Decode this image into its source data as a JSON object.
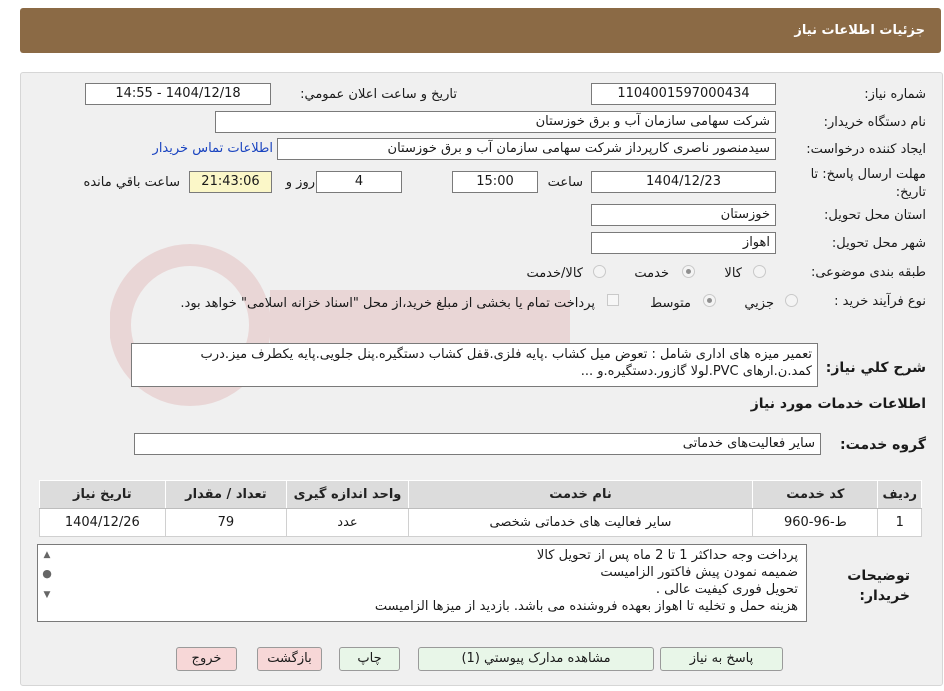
{
  "header": {
    "title": "جزئیات اطلاعات نیاز"
  },
  "fields": {
    "need_number_label": "شماره نیاز:",
    "need_number": "1104001597000434",
    "announce_label": "تاریخ و ساعت اعلان عمومي:",
    "announce_value": "1404/12/18 - 14:55",
    "buyer_org_label": "نام دستگاه خريدار:",
    "buyer_org": "شرکت سهامی سازمان آب و برق خوزستان",
    "requester_label": "ايجاد کننده درخواست:",
    "requester": "سیدمنصور ناصری کارپرداز شرکت سهامی سازمان آب و برق خوزستان",
    "contact_link": "اطلاعات تماس خريدار",
    "deadline_label": "مهلت ارسال پاسخ: تا تاریخ:",
    "deadline_date": "1404/12/23",
    "time_label": "ساعت",
    "deadline_time": "15:00",
    "days_value": "4",
    "days_label": "روز و",
    "remaining_time": "21:43:06",
    "remaining_label": "ساعت باقي مانده",
    "province_label": "استان محل تحويل:",
    "province": "خوزستان",
    "city_label": "شهر محل تحويل:",
    "city": "اهواز",
    "category_label": "طبقه بندی موضوعی:",
    "category_options": [
      "کالا",
      "خدمت",
      "کالا/خدمت"
    ],
    "category_selected": "خدمت",
    "process_label": "نوع فرآیند خرید :",
    "process_options": [
      "جزيي",
      "متوسط"
    ],
    "process_selected": "متوسط",
    "payment_note": "پرداخت تمام یا بخشی از مبلغ خرید،از محل \"اسناد خزانه اسلامی\" خواهد بود."
  },
  "description": {
    "label": "شرح کلي نياز:",
    "text": "تعمیر میزه های اداری شامل : تعوض میل کشاب .پایه فلزی.قفل کشاب دستگیره.پنل جلویی.پایه یکطرف میز.درب کمد.ن.ارهای PVC.لولا گازور.دستگیره.و ..."
  },
  "services": {
    "section_title": "اطلاعات خدمات مورد نياز",
    "group_label": "گروه خدمت:",
    "group_value": "ساير فعاليت‌هاى خدماتى",
    "columns": [
      "رديف",
      "کد خدمت",
      "نام خدمت",
      "واحد اندازه گيری",
      "تعداد / مقدار",
      "تاريخ نياز"
    ],
    "rows": [
      {
        "index": "1",
        "code": "ط-96-960",
        "name": "سایر فعالیت های خدماتی شخصی",
        "unit": "عدد",
        "qty": "79",
        "date": "1404/12/26"
      }
    ]
  },
  "buyer_notes": {
    "label": "توضيحات خريدار:",
    "lines": [
      "پرداخت وجه حداکثر 1 تا 2 ماه پس از تحویل کالا",
      "ضمیمه نمودن پیش فاکتور الزامیست",
      "تحویل فوری کیفیت عالی .",
      "هزینه حمل و تخلیه تا اهواز بعهده فروشنده می باشد. بازدید از میزها الزامیست"
    ]
  },
  "buttons": {
    "respond": "پاسخ به نياز",
    "attachments": "مشاهده مدارک پيوستي (1)",
    "print": "چاپ",
    "back": "بازگشت",
    "exit": "خروج"
  },
  "colors": {
    "header_bg": "#8b6a45",
    "panel_bg": "#f0f0f0",
    "button_green": "#e8f6e8",
    "button_pink": "#f7d7d7"
  }
}
